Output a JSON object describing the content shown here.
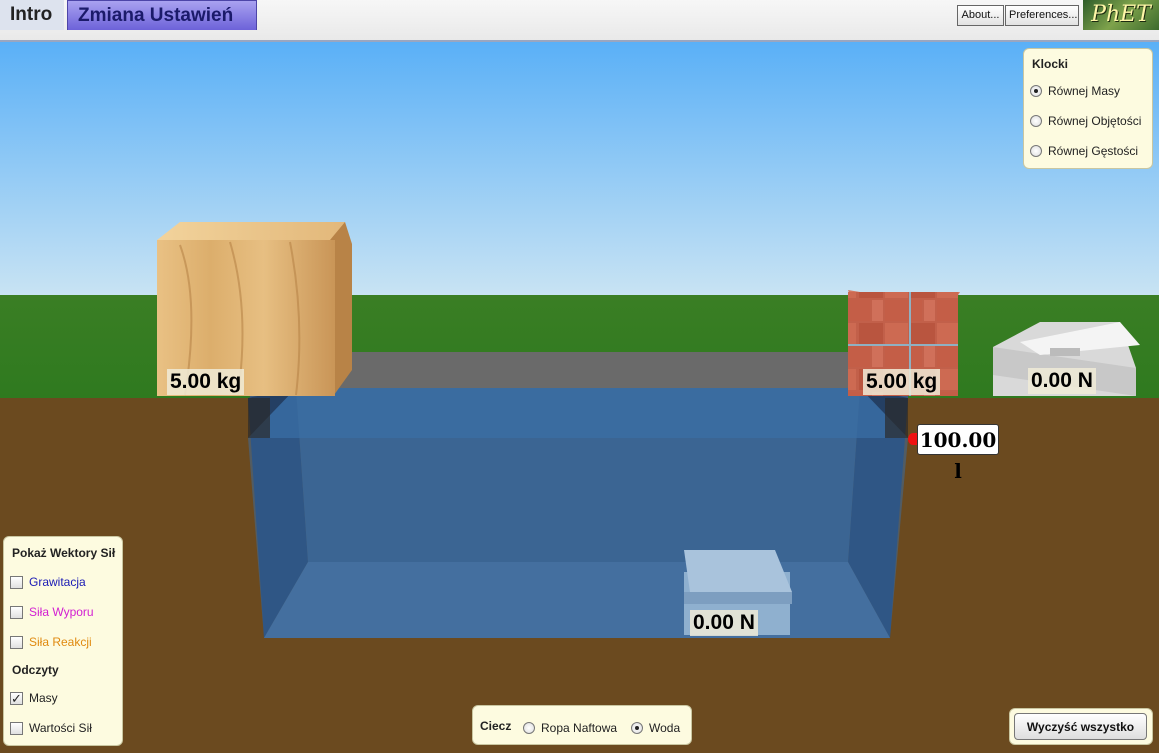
{
  "tabs": [
    {
      "label": "Intro",
      "active": false
    },
    {
      "label": "Zmiana Ustawień",
      "active": true
    }
  ],
  "header": {
    "about_label": "About...",
    "preferences_label": "Preferences...",
    "logo_text": "PhET"
  },
  "scene": {
    "wood_mass": "5.00 kg",
    "brick_mass": "5.00 kg",
    "scale_right_reading": "0.00 N",
    "scale_pool_reading": "0.00 N",
    "volume_readout": "100.00 l"
  },
  "blocks_panel": {
    "title": "Klocki",
    "options": [
      {
        "label": "Równej Masy",
        "selected": true
      },
      {
        "label": "Równej Objętości",
        "selected": false
      },
      {
        "label": "Równej Gęstości",
        "selected": false
      }
    ]
  },
  "forces_panel": {
    "title": "Pokaż Wektory Sił",
    "options": [
      {
        "label": "Grawitacja",
        "checked": false,
        "color": "#1a1ab5"
      },
      {
        "label": "Siła Wyporu",
        "checked": false,
        "color": "#d21fd2"
      },
      {
        "label": "Siła Reakcji",
        "checked": false,
        "color": "#e08a10"
      }
    ],
    "readouts_title": "Odczyty",
    "readouts": [
      {
        "label": "Masy",
        "checked": true
      },
      {
        "label": "Wartości Sił",
        "checked": false
      }
    ]
  },
  "fluid_panel": {
    "title": "Ciecz",
    "options": [
      {
        "label": "Ropa Naftowa",
        "selected": false
      },
      {
        "label": "Woda",
        "selected": true
      }
    ]
  },
  "reset_label": "Wyczyść wszystko",
  "colors": {
    "sky": "#5ab0f7",
    "grass": "#2f7a1f",
    "dirt": "#6b4a1f",
    "water": "#3d6fa8",
    "panel_bg": "#fdfbe0"
  }
}
